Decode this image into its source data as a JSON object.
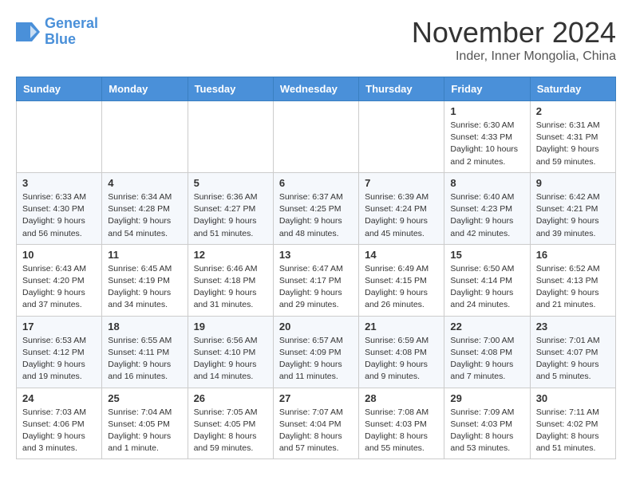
{
  "header": {
    "logo_line1": "General",
    "logo_line2": "Blue",
    "month_title": "November 2024",
    "location": "Inder, Inner Mongolia, China"
  },
  "weekdays": [
    "Sunday",
    "Monday",
    "Tuesday",
    "Wednesday",
    "Thursday",
    "Friday",
    "Saturday"
  ],
  "weeks": [
    [
      {
        "day": "",
        "info": ""
      },
      {
        "day": "",
        "info": ""
      },
      {
        "day": "",
        "info": ""
      },
      {
        "day": "",
        "info": ""
      },
      {
        "day": "",
        "info": ""
      },
      {
        "day": "1",
        "info": "Sunrise: 6:30 AM\nSunset: 4:33 PM\nDaylight: 10 hours\nand 2 minutes."
      },
      {
        "day": "2",
        "info": "Sunrise: 6:31 AM\nSunset: 4:31 PM\nDaylight: 9 hours\nand 59 minutes."
      }
    ],
    [
      {
        "day": "3",
        "info": "Sunrise: 6:33 AM\nSunset: 4:30 PM\nDaylight: 9 hours\nand 56 minutes."
      },
      {
        "day": "4",
        "info": "Sunrise: 6:34 AM\nSunset: 4:28 PM\nDaylight: 9 hours\nand 54 minutes."
      },
      {
        "day": "5",
        "info": "Sunrise: 6:36 AM\nSunset: 4:27 PM\nDaylight: 9 hours\nand 51 minutes."
      },
      {
        "day": "6",
        "info": "Sunrise: 6:37 AM\nSunset: 4:25 PM\nDaylight: 9 hours\nand 48 minutes."
      },
      {
        "day": "7",
        "info": "Sunrise: 6:39 AM\nSunset: 4:24 PM\nDaylight: 9 hours\nand 45 minutes."
      },
      {
        "day": "8",
        "info": "Sunrise: 6:40 AM\nSunset: 4:23 PM\nDaylight: 9 hours\nand 42 minutes."
      },
      {
        "day": "9",
        "info": "Sunrise: 6:42 AM\nSunset: 4:21 PM\nDaylight: 9 hours\nand 39 minutes."
      }
    ],
    [
      {
        "day": "10",
        "info": "Sunrise: 6:43 AM\nSunset: 4:20 PM\nDaylight: 9 hours\nand 37 minutes."
      },
      {
        "day": "11",
        "info": "Sunrise: 6:45 AM\nSunset: 4:19 PM\nDaylight: 9 hours\nand 34 minutes."
      },
      {
        "day": "12",
        "info": "Sunrise: 6:46 AM\nSunset: 4:18 PM\nDaylight: 9 hours\nand 31 minutes."
      },
      {
        "day": "13",
        "info": "Sunrise: 6:47 AM\nSunset: 4:17 PM\nDaylight: 9 hours\nand 29 minutes."
      },
      {
        "day": "14",
        "info": "Sunrise: 6:49 AM\nSunset: 4:15 PM\nDaylight: 9 hours\nand 26 minutes."
      },
      {
        "day": "15",
        "info": "Sunrise: 6:50 AM\nSunset: 4:14 PM\nDaylight: 9 hours\nand 24 minutes."
      },
      {
        "day": "16",
        "info": "Sunrise: 6:52 AM\nSunset: 4:13 PM\nDaylight: 9 hours\nand 21 minutes."
      }
    ],
    [
      {
        "day": "17",
        "info": "Sunrise: 6:53 AM\nSunset: 4:12 PM\nDaylight: 9 hours\nand 19 minutes."
      },
      {
        "day": "18",
        "info": "Sunrise: 6:55 AM\nSunset: 4:11 PM\nDaylight: 9 hours\nand 16 minutes."
      },
      {
        "day": "19",
        "info": "Sunrise: 6:56 AM\nSunset: 4:10 PM\nDaylight: 9 hours\nand 14 minutes."
      },
      {
        "day": "20",
        "info": "Sunrise: 6:57 AM\nSunset: 4:09 PM\nDaylight: 9 hours\nand 11 minutes."
      },
      {
        "day": "21",
        "info": "Sunrise: 6:59 AM\nSunset: 4:08 PM\nDaylight: 9 hours\nand 9 minutes."
      },
      {
        "day": "22",
        "info": "Sunrise: 7:00 AM\nSunset: 4:08 PM\nDaylight: 9 hours\nand 7 minutes."
      },
      {
        "day": "23",
        "info": "Sunrise: 7:01 AM\nSunset: 4:07 PM\nDaylight: 9 hours\nand 5 minutes."
      }
    ],
    [
      {
        "day": "24",
        "info": "Sunrise: 7:03 AM\nSunset: 4:06 PM\nDaylight: 9 hours\nand 3 minutes."
      },
      {
        "day": "25",
        "info": "Sunrise: 7:04 AM\nSunset: 4:05 PM\nDaylight: 9 hours\nand 1 minute."
      },
      {
        "day": "26",
        "info": "Sunrise: 7:05 AM\nSunset: 4:05 PM\nDaylight: 8 hours\nand 59 minutes."
      },
      {
        "day": "27",
        "info": "Sunrise: 7:07 AM\nSunset: 4:04 PM\nDaylight: 8 hours\nand 57 minutes."
      },
      {
        "day": "28",
        "info": "Sunrise: 7:08 AM\nSunset: 4:03 PM\nDaylight: 8 hours\nand 55 minutes."
      },
      {
        "day": "29",
        "info": "Sunrise: 7:09 AM\nSunset: 4:03 PM\nDaylight: 8 hours\nand 53 minutes."
      },
      {
        "day": "30",
        "info": "Sunrise: 7:11 AM\nSunset: 4:02 PM\nDaylight: 8 hours\nand 51 minutes."
      }
    ]
  ]
}
